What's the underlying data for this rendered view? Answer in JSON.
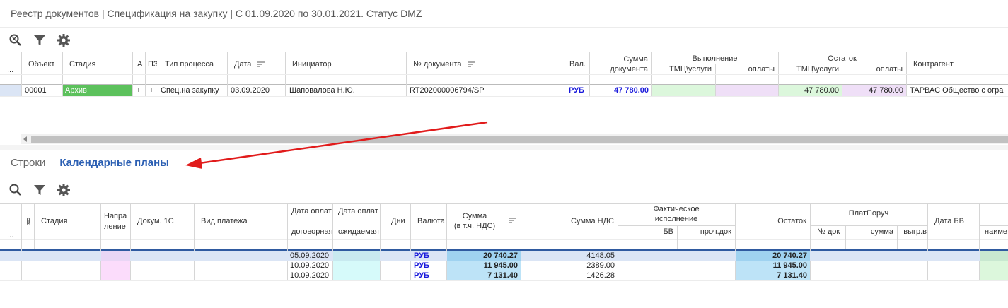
{
  "title": "Реестр документов | Спецификация на закупку | С 01.09.2020 по 30.01.2021. Статус DMZ",
  "colors": {
    "green": "#5cc15c",
    "light_green": "#dcf7dc",
    "light_purple": "#efdff7",
    "light_cyan": "#d6fafa",
    "light_blue": "#bde3f7",
    "pink": "#fbdcfb",
    "selection": "#dbe5f5",
    "blue_text": "#1a1adb",
    "arrow": "#e11b1b"
  },
  "top_toolbar": {
    "icons": [
      "zoom-reset-icon",
      "filter-icon",
      "gear-icon"
    ]
  },
  "top_grid": {
    "menu_dots": "...",
    "headers": {
      "object": "Объект",
      "stage": "Стадия",
      "a": "А",
      "pz": "ПЗ",
      "process_type": "Тип процесса",
      "date": "Дата",
      "initiator": "Инициатор",
      "doc_no": "№ документа",
      "currency": "Вал.",
      "doc_sum_1": "Сумма",
      "doc_sum_2": "документа",
      "execution": "Выполнение",
      "exec_goods": "ТМЦ\\услуги",
      "exec_payments": "оплаты",
      "remainder": "Остаток",
      "rem_goods": "ТМЦ\\услуги",
      "rem_payments": "оплаты",
      "counterparty": "Контрагент"
    },
    "rows": [
      {
        "object": "00001",
        "stage": "Архив",
        "a": "+",
        "pz": "+",
        "process_type": "Спец.на закупку",
        "date": "03.09.2020",
        "initiator": "Шаповалова Н.Ю.",
        "doc_no": "RT202000006794/SP",
        "currency": "РУБ",
        "doc_sum": "47 780.00",
        "exec_goods": "",
        "exec_payments": "",
        "rem_goods": "47 780.00",
        "rem_payments": "47 780.00",
        "counterparty": "ТАРВАС Общество с огра"
      }
    ]
  },
  "tabs": [
    {
      "label": "Строки",
      "active": false
    },
    {
      "label": "Календарные планы",
      "active": true
    }
  ],
  "bottom_toolbar": {
    "icons": [
      "search-icon",
      "filter-icon",
      "gear-icon"
    ]
  },
  "bottom_grid": {
    "menu_dots": "...",
    "headers": {
      "stage": "Стадия",
      "direction_1": "Напра",
      "direction_2": "ление",
      "doc_1c": "Докум. 1С",
      "payment_type": "Вид платежа",
      "pay_date_contract_1": "Дата оплат",
      "pay_date_contract_2": "договорная",
      "pay_date_expected_1": "Дата оплат",
      "pay_date_expected_2": "ожидаемая",
      "days": "Дни",
      "currency": "Валюта",
      "sum_1": "Сумма",
      "sum_2": "(в т.ч. НДС)",
      "vat_sum": "Сумма НДС",
      "actual_1": "Фактическое",
      "actual_2": "исполнение",
      "bv": "БВ",
      "other_doc": "проч.док",
      "remainder": "Остаток",
      "payment_order": "ПлатПоруч",
      "po_no": "№ док",
      "po_sum": "сумма",
      "po_upload": "выгр.в",
      "bv_date": "Дата БВ",
      "name": "наиме"
    },
    "rows": [
      {
        "pay_date": "05.09.2020",
        "currency": "РУБ",
        "sum": "20 740.27",
        "vat": "4148.05",
        "remainder": "20 740.27"
      },
      {
        "pay_date": "10.09.2020",
        "currency": "РУБ",
        "sum": "11 945.00",
        "vat": "2389.00",
        "remainder": "11 945.00"
      },
      {
        "pay_date": "10.09.2020",
        "currency": "РУБ",
        "sum": "7 131.40",
        "vat": "1426.28",
        "remainder": "7 131.40"
      }
    ]
  }
}
